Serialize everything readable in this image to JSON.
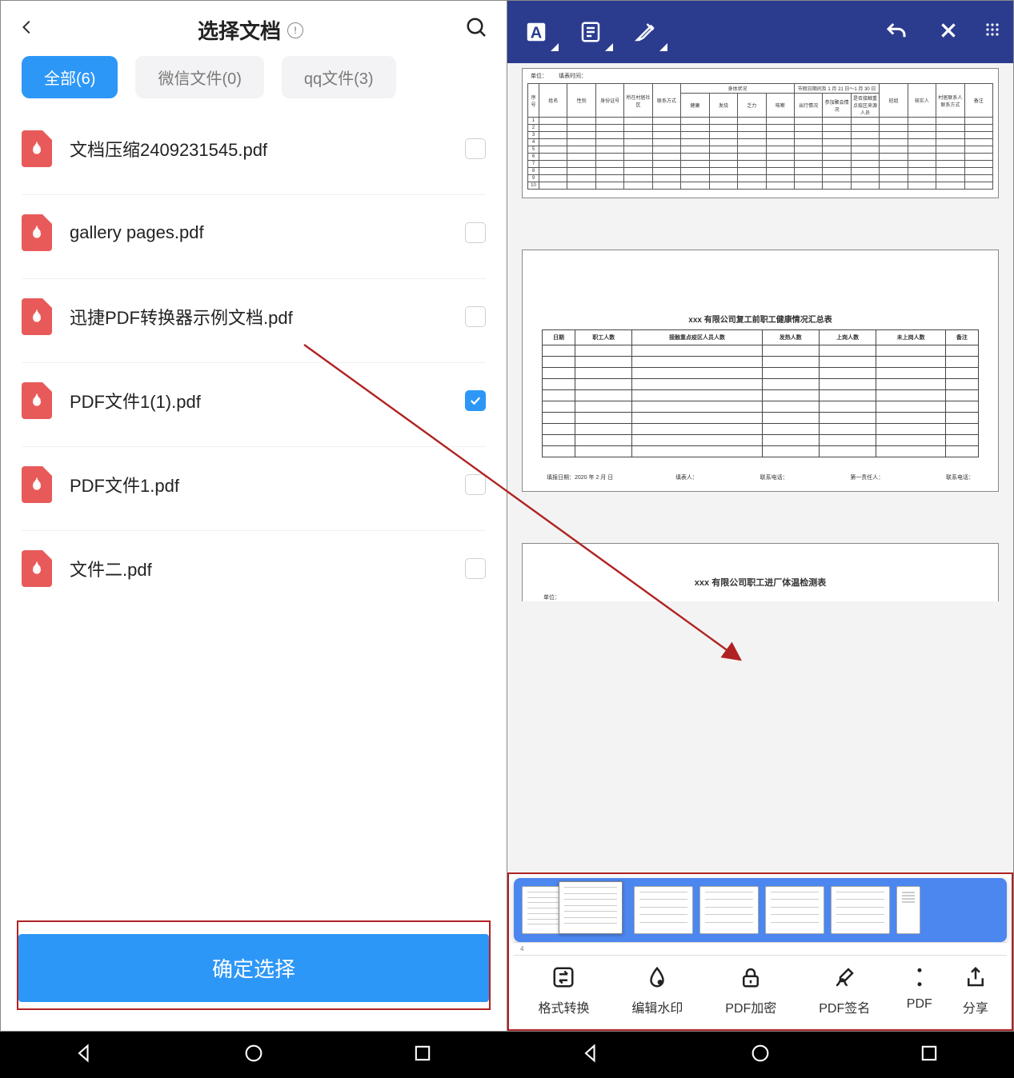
{
  "left": {
    "header": {
      "title": "选择文档",
      "back_icon": "chevron-left",
      "info_icon": "!",
      "search_icon": "search"
    },
    "tabs": [
      {
        "label": "全部(6)",
        "active": true
      },
      {
        "label": "微信文件(0)",
        "active": false
      },
      {
        "label": "qq文件(3)",
        "active": false
      }
    ],
    "files": [
      {
        "name": "文档压缩2409231545.pdf",
        "checked": false
      },
      {
        "name": "gallery pages.pdf",
        "checked": false
      },
      {
        "name": "迅捷PDF转换器示例文档.pdf",
        "checked": false
      },
      {
        "name": "PDF文件1(1).pdf",
        "checked": true
      },
      {
        "name": "PDF文件1.pdf",
        "checked": false
      },
      {
        "name": "文件二.pdf",
        "checked": false
      }
    ],
    "confirm_button": "确定选择"
  },
  "right": {
    "header_icons": [
      "text-tool-A",
      "note-tool",
      "highlighter-pen",
      "undo",
      "close",
      "more-grid"
    ],
    "page1": {
      "meta_left": "单位：",
      "meta_right": "填表时间：",
      "header_group_body": "身体状况",
      "header_group_holiday": "节假日期间及 1 月 21 日～1 月 30 日",
      "col1": "序号",
      "col2": "姓名",
      "col3": "性别",
      "col4": "身份证号",
      "col5": "所在村居社区",
      "col6": "联系方式",
      "col7": "健康",
      "col8": "发烧",
      "col9": "乏力",
      "col10": "咳嗽",
      "col11": "出行情况",
      "col12": "参加聚会情况",
      "col13": "是否接触重点疫区来源人员",
      "col14": "班组",
      "col15": "核实人",
      "col16": "村居联系人联系方式",
      "col17": "备注",
      "row_count": 10
    },
    "page2": {
      "title": "xxx 有限公司复工前职工健康情况汇总表",
      "headers": [
        "日期",
        "职工人数",
        "接触重点疫区人员人数",
        "发热人数",
        "上岗人数",
        "未上岗人数",
        "备注"
      ],
      "blank_rows": 10,
      "footer": {
        "date": "填报日期：2020 年 2 月   日",
        "filler": "填表人：",
        "phone1": "联系电话：",
        "resp": "第一责任人：",
        "phone2": "联系电话："
      }
    },
    "page3": {
      "title": "xxx 有限公司职工进厂体温检测表",
      "sub": "单位："
    },
    "thumbnails_count": 6,
    "page_indicator_current": "4",
    "toolbar": [
      {
        "label": "格式转换",
        "icon": "convert"
      },
      {
        "label": "编辑水印",
        "icon": "watermark-drop"
      },
      {
        "label": "PDF加密",
        "icon": "lock"
      },
      {
        "label": "PDF签名",
        "icon": "signature-pen"
      },
      {
        "label": "PDF",
        "icon": "more-dots"
      },
      {
        "label": "分享",
        "icon": "share-up"
      }
    ]
  },
  "annotation": {
    "arrow_color": "#b02222"
  },
  "colors": {
    "blue_primary": "#2d97f7",
    "blue_header": "#2b3c8f",
    "red_annotation": "#b02222",
    "pdf_red": "#e85a5a"
  }
}
